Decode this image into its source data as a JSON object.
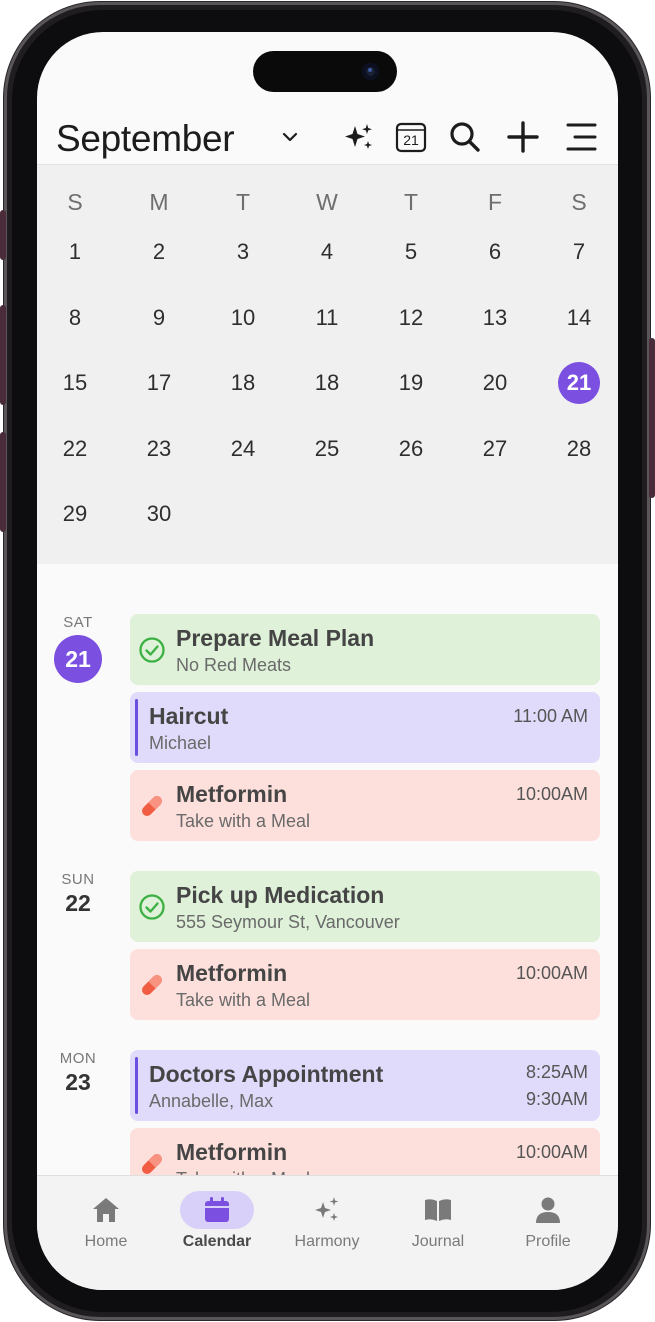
{
  "header": {
    "month": "September",
    "calendar_badge": "21"
  },
  "calendar": {
    "weekdays": [
      "S",
      "M",
      "T",
      "W",
      "T",
      "F",
      "S"
    ],
    "weeks": [
      [
        "1",
        "2",
        "3",
        "4",
        "5",
        "6",
        "7"
      ],
      [
        "8",
        "9",
        "10",
        "11",
        "12",
        "13",
        "14"
      ],
      [
        "15",
        "17",
        "18",
        "18",
        "19",
        "20",
        "21"
      ],
      [
        "22",
        "23",
        "24",
        "25",
        "26",
        "27",
        "28"
      ],
      [
        "29",
        "30",
        "",
        "",
        "",
        "",
        ""
      ]
    ],
    "selected": "21",
    "accent_color": "#7b4fe0"
  },
  "agenda": {
    "days": [
      {
        "dow": "SAT",
        "num": "21",
        "events": [
          {
            "kind": "task",
            "title": "Prepare Meal Plan",
            "subtitle": "No Red Meats",
            "time": "",
            "color": "#dff1d9",
            "icon": "check-circle-icon"
          },
          {
            "kind": "appointment",
            "title": "Haircut",
            "subtitle": "Michael",
            "time": "11:00 AM",
            "color": "#e0dbfa",
            "icon": "accent-bar"
          },
          {
            "kind": "medication",
            "title": "Metformin",
            "subtitle": "Take with a Meal",
            "time": "10:00AM",
            "color": "#fde0dc",
            "icon": "pill-icon"
          }
        ]
      },
      {
        "dow": "SUN",
        "num": "22",
        "events": [
          {
            "kind": "task",
            "title": "Pick up Medication",
            "subtitle": "555 Seymour St, Vancouver",
            "time": "",
            "color": "#dff1d9",
            "icon": "check-circle-icon"
          },
          {
            "kind": "medication",
            "title": "Metformin",
            "subtitle": "Take with a Meal",
            "time": "10:00AM",
            "color": "#fde0dc",
            "icon": "pill-icon"
          }
        ]
      },
      {
        "dow": "MON",
        "num": "23",
        "events": [
          {
            "kind": "appointment",
            "title": "Doctors Appointment",
            "subtitle": "Annabelle, Max",
            "time": "8:25AM",
            "time_end": "9:30AM",
            "color": "#e0dbfa",
            "icon": "accent-bar"
          },
          {
            "kind": "medication",
            "title": "Metformin",
            "subtitle": "Take with a Meal",
            "time": "10:00AM",
            "color": "#fde0dc",
            "icon": "pill-icon"
          }
        ]
      }
    ]
  },
  "nav": {
    "items": [
      {
        "label": "Home",
        "icon": "home-icon",
        "active": false
      },
      {
        "label": "Calendar",
        "icon": "calendar-icon",
        "active": true
      },
      {
        "label": "Harmony",
        "icon": "sparkle-icon",
        "active": false
      },
      {
        "label": "Journal",
        "icon": "book-icon",
        "active": false
      },
      {
        "label": "Profile",
        "icon": "person-icon",
        "active": false
      }
    ]
  }
}
